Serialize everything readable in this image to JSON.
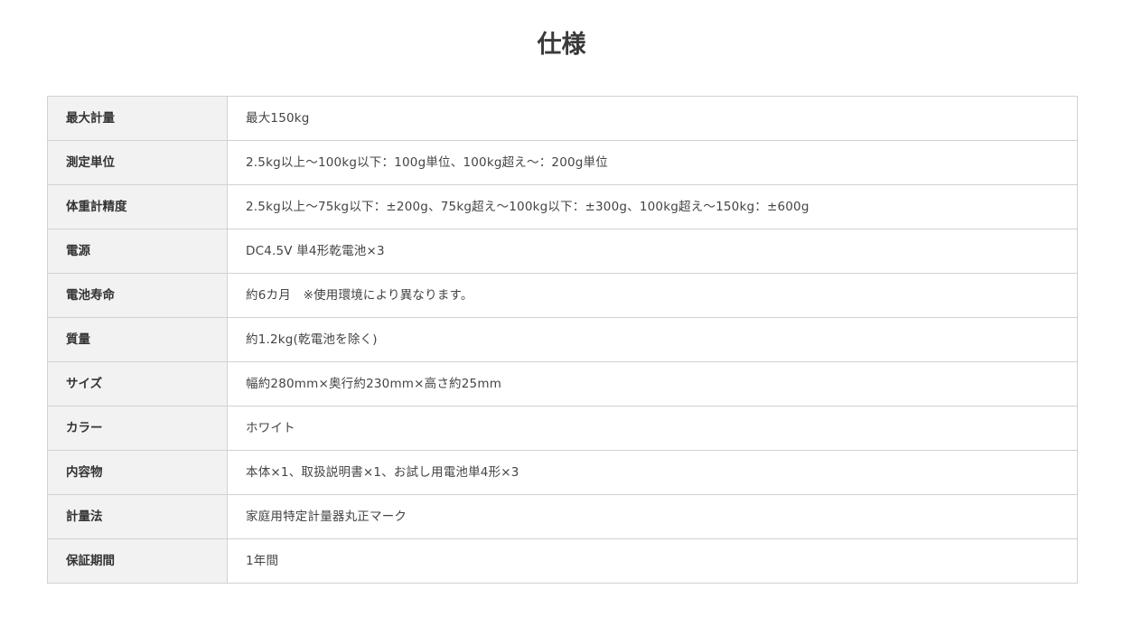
{
  "title": "仕様",
  "specs": [
    {
      "label": "最大計量",
      "value": "最大150kg"
    },
    {
      "label": "測定単位",
      "value": "2.5kg以上〜100kg以下：100g単位、100kg超え〜：200g単位"
    },
    {
      "label": "体重計精度",
      "value": "2.5kg以上〜75kg以下：±200g、75kg超え〜100kg以下：±300g、100kg超え〜150kg：±600g"
    },
    {
      "label": "電源",
      "value": "DC4.5V 単4形乾電池×3"
    },
    {
      "label": "電池寿命",
      "value": "約6カ月　※使用環境により異なります。"
    },
    {
      "label": "質量",
      "value": "約1.2kg(乾電池を除く)"
    },
    {
      "label": "サイズ",
      "value": "幅約280mm×奥行約230mm×高さ約25mm"
    },
    {
      "label": "カラー",
      "value": "ホワイト"
    },
    {
      "label": "内容物",
      "value": "本体×1、取扱説明書×1、お試し用電池単4形×3"
    },
    {
      "label": "計量法",
      "value": "家庭用特定計量器丸正マーク"
    },
    {
      "label": "保証期間",
      "value": "1年間"
    }
  ]
}
